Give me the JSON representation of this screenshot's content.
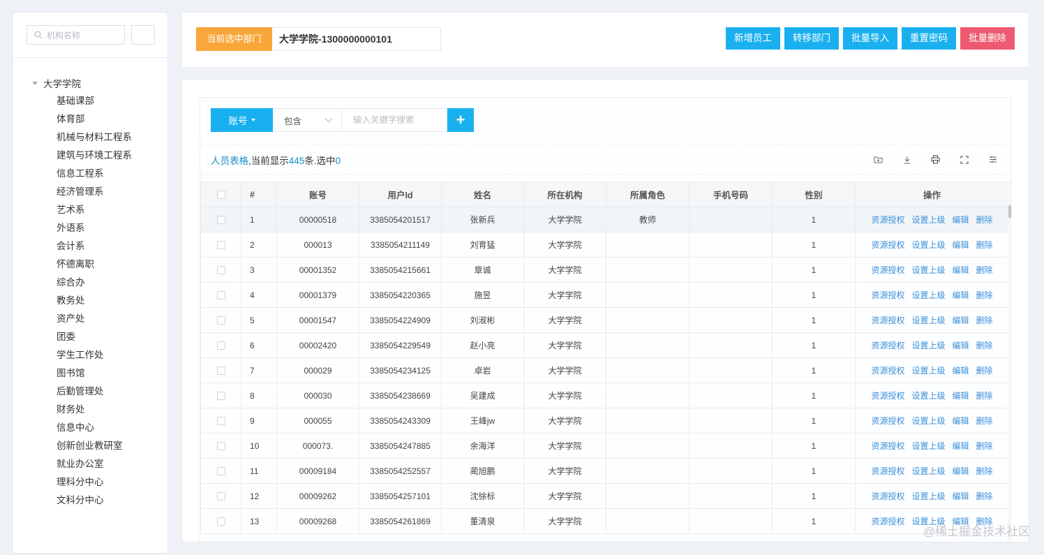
{
  "sidebar": {
    "search_placeholder": "机构名称",
    "tree": {
      "root": "大学学院",
      "children": [
        "基础课部",
        "体育部",
        "机械与材料工程系",
        "建筑与环境工程系",
        "信息工程系",
        "经济管理系",
        "艺术系",
        "外语系",
        "会计系",
        "怀德离职",
        "综合办",
        "教务处",
        "资产处",
        "团委",
        "学生工作处",
        "图书馆",
        "后勤管理处",
        "财务处",
        "信息中心",
        "创新创业教研室",
        "就业办公室",
        "理科分中心",
        "文科分中心"
      ]
    }
  },
  "header": {
    "dept_label": "当前选中部门",
    "dept_value": "大学学院-1300000000101",
    "actions": {
      "add": "新增员工",
      "transfer": "转移部门",
      "import": "批量导入",
      "reset": "重置密码",
      "delete": "批量删除"
    },
    "colors": {
      "accent": "#1ab0ef",
      "warning": "#f9a63b",
      "danger": "#ee5a6f"
    }
  },
  "filter": {
    "field": "账号",
    "operator": "包含",
    "keyword_placeholder": "输入关键字搜索",
    "add_symbol": "+"
  },
  "caption": {
    "title": "人员表格",
    "text1": ",当前显示",
    "shown": "445",
    "text2": "条.选中",
    "selected": "0"
  },
  "toolbar_icons": [
    "folder-icon",
    "download-icon",
    "print-icon",
    "fullscreen-icon",
    "filter-settings-icon"
  ],
  "table": {
    "headers": [
      "#",
      "账号",
      "用户Id",
      "姓名",
      "所在机构",
      "所属角色",
      "手机号码",
      "性别",
      "操作"
    ],
    "row_actions": [
      "资源授权",
      "设置上级",
      "编辑",
      "删除"
    ],
    "rows": [
      [
        "1",
        "00000518",
        "3385054201517",
        "张新兵",
        "大学学院",
        "教师",
        "",
        "1"
      ],
      [
        "2",
        "000013",
        "3385054211149",
        "刘育猛",
        "大学学院",
        "",
        "",
        "1"
      ],
      [
        "3",
        "00001352",
        "3385054215661",
        "章诚",
        "大学学院",
        "",
        "",
        "1"
      ],
      [
        "4",
        "00001379",
        "3385054220365",
        "施昱",
        "大学学院",
        "",
        "",
        "1"
      ],
      [
        "5",
        "00001547",
        "3385054224909",
        "刘淑彬",
        "大学学院",
        "",
        "",
        "1"
      ],
      [
        "6",
        "00002420",
        "3385054229549",
        "赵小亮",
        "大学学院",
        "",
        "",
        "1"
      ],
      [
        "7",
        "000029",
        "3385054234125",
        "卓岩",
        "大学学院",
        "",
        "",
        "1"
      ],
      [
        "8",
        "000030",
        "3385054238669",
        "吴建成",
        "大学学院",
        "",
        "",
        "1"
      ],
      [
        "9",
        "000055",
        "3385054243309",
        "王峰jw",
        "大学学院",
        "",
        "",
        "1"
      ],
      [
        "10",
        "000073.",
        "3385054247885",
        "余海洋",
        "大学学院",
        "",
        "",
        "1"
      ],
      [
        "11",
        "00009184",
        "3385054252557",
        "蔺旭鹏",
        "大学学院",
        "",
        "",
        "1"
      ],
      [
        "12",
        "00009262",
        "3385054257101",
        "沈徐标",
        "大学学院",
        "",
        "",
        "1"
      ],
      [
        "13",
        "00009268",
        "3385054261869",
        "董清泉",
        "大学学院",
        "",
        "",
        "1"
      ]
    ]
  },
  "watermark": "@稀土掘金技术社区"
}
